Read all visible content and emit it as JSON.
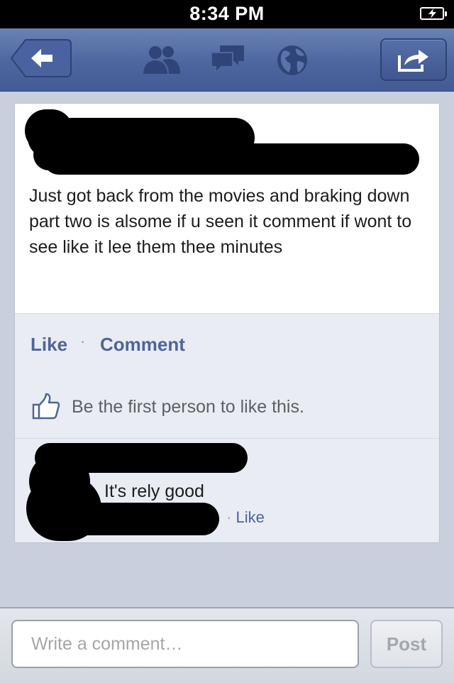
{
  "status_bar": {
    "time": "8:34 PM",
    "battery_icon": "battery-charging-icon"
  },
  "nav_bar": {
    "back_icon": "back-arrow-icon",
    "friends_icon": "friends-icon",
    "messages_icon": "messages-icon",
    "notifications_icon": "globe-icon",
    "share_icon": "share-icon",
    "colors": {
      "nav": "#4d66a0",
      "link": "#4e6596"
    }
  },
  "post": {
    "text": "Just got back from the movies and braking down part two is alsome if u seen it comment if wont to see like it lee them thee minutes",
    "actions": {
      "like": "Like",
      "separator": "·",
      "comment": "Comment"
    },
    "like_summary": "Be the first person to like this."
  },
  "comment": {
    "text": "It's rely good",
    "separator": "·",
    "like": "Like"
  },
  "composer": {
    "placeholder": "Write a comment…",
    "post_label": "Post"
  }
}
